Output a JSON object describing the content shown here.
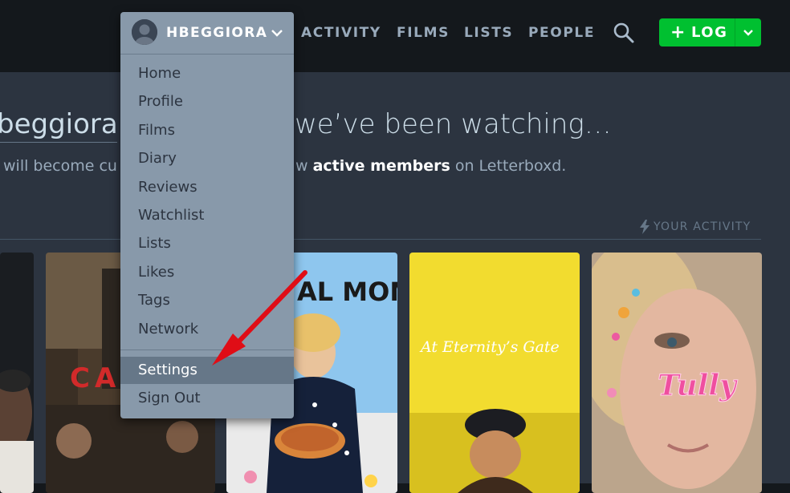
{
  "nav": {
    "username": "HBEGGIORA",
    "links": [
      "ACTIVITY",
      "FILMS",
      "LISTS",
      "PEOPLE"
    ],
    "log_label": "LOG",
    "log_plus": "+"
  },
  "dropdown": {
    "items": [
      "Home",
      "Profile",
      "Films",
      "Diary",
      "Reviews",
      "Watchlist",
      "Lists",
      "Likes",
      "Tags",
      "Network"
    ],
    "settings": "Settings",
    "sign_out": "Sign Out"
  },
  "main": {
    "headline_user": "beggiora.",
    "headline_text": "we’ve been watching…",
    "subline_start": "will become cu",
    "subline_mid": "w ",
    "subline_bold": "active members",
    "subline_end": " on Letterboxd.",
    "activity_label": "YOUR ACTIVITY"
  },
  "posters": {
    "poster_2_text": "CA",
    "poster_3_text": "AL MOM",
    "poster_4_text": "At Eternity’s Gate",
    "poster_5_text": "Tully"
  },
  "colors": {
    "topbar_bg": "#14181c",
    "page_bg": "#2c3440",
    "log_green": "#00c030",
    "dropdown_bg": "#8899aa",
    "dropdown_active": "#667788",
    "arrow_red": "#e00d16"
  }
}
